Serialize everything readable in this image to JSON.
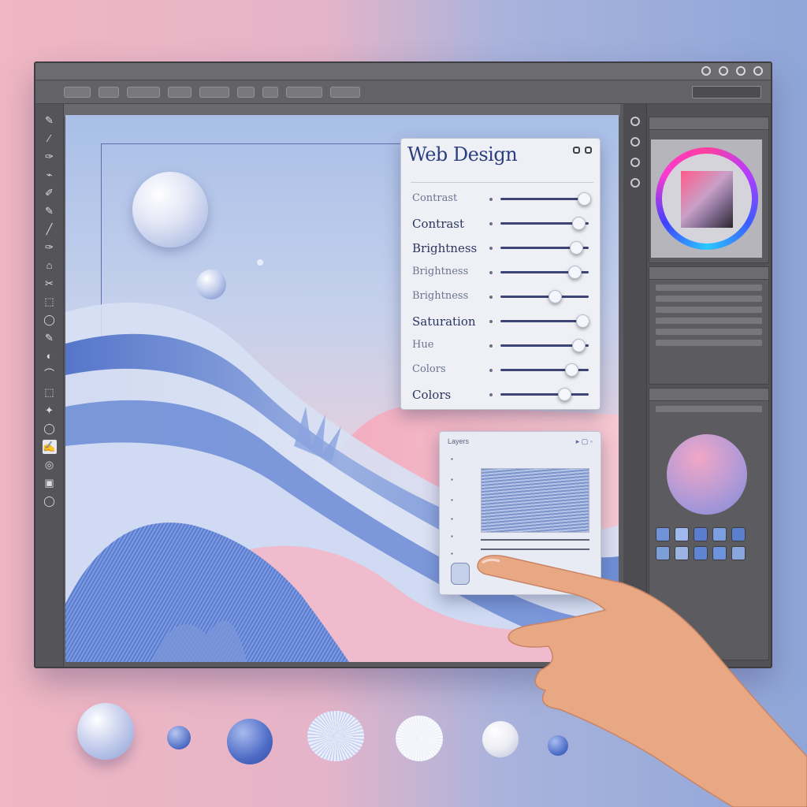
{
  "window": {
    "menu": [
      "",
      "",
      "",
      "",
      "",
      "",
      ""
    ],
    "document_tab": ""
  },
  "tools": [
    "✎",
    "⁄",
    "✑",
    "⌁",
    "✐",
    "✎",
    "╱",
    "✑",
    "⌂",
    "✂",
    "⬚",
    "◯",
    "✎",
    "◐",
    "⌒",
    "⬚",
    "✦",
    "◯",
    "✍",
    "◎",
    "▣",
    "◯"
  ],
  "adjustments_panel": {
    "title": "Web Design",
    "sliders": [
      {
        "label": "Contrast",
        "value": 0.95
      },
      {
        "label": "Contrast",
        "value": 0.88
      },
      {
        "label": "Brightness",
        "value": 0.86
      },
      {
        "label": "Brightness",
        "value": 0.84
      },
      {
        "label": "Brightness",
        "value": 0.62
      },
      {
        "label": "Saturation",
        "value": 0.93
      },
      {
        "label": "Hue",
        "value": 0.88
      },
      {
        "label": "Colors",
        "value": 0.8
      },
      {
        "label": "Colors",
        "value": 0.72
      }
    ]
  },
  "layers_panel": {
    "title": "Layers"
  },
  "colors": {
    "accent_blue": "#3c4575",
    "panel_bg": "#eef0f6",
    "ui_dark": "#5a5a5e",
    "swatch_colors": [
      "#6f92d8",
      "#9fb8ee",
      "#5b7dd0",
      "#7aa0e0",
      "#5a7fcc",
      "#7c9fd7",
      "#9cb4e4",
      "#5f84d2",
      "#6d93dc",
      "#89a7dd"
    ]
  },
  "icons": [
    "search-icon",
    "gear-icon",
    "minimize-icon",
    "close-icon",
    "hand-pointer"
  ]
}
